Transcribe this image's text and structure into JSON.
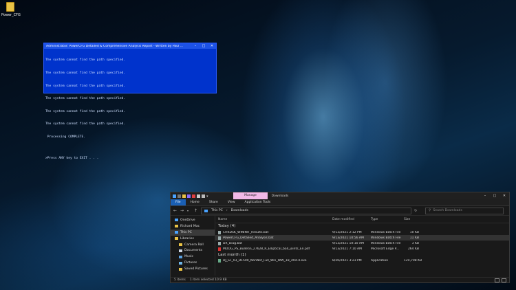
{
  "desktop": {
    "icon_label": "Power_CFG"
  },
  "console": {
    "title": "Administrator:  PowerCFG Detailed & Comprehensive Analysis Report - Written by Paul ...",
    "lines": [
      "The system cannot find the path specified.",
      "The system cannot find the path specified.",
      "The system cannot find the path specified.",
      "The system cannot find the path specified.",
      "The system cannot find the path specified.",
      "The system cannot find the path specified.",
      " Processing COMPLETE.",
      "",
      ">Press ANY key to EXIT . . ."
    ],
    "bg_color": "#0033cc"
  },
  "explorer": {
    "title_tabs": {
      "manage": "Manage",
      "downloads": "Downloads"
    },
    "ribbon_tabs": [
      "File",
      "Home",
      "Share",
      "View",
      "Application Tools"
    ],
    "address": {
      "this_pc": "This PC",
      "folder": "Downloads"
    },
    "search_placeholder": "Search Downloads",
    "nav_items": [
      {
        "label": "OneDrive"
      },
      {
        "label": "Richard Mac"
      },
      {
        "label": "This PC"
      },
      {
        "label": "Libraries"
      },
      {
        "label": "Camera Roll"
      },
      {
        "label": "Documents"
      },
      {
        "label": "Music"
      },
      {
        "label": "Pictures"
      },
      {
        "label": "Saved Pictures"
      }
    ],
    "columns": {
      "name": "Name",
      "date": "Date modified",
      "type": "Type",
      "size": "Size"
    },
    "groups": [
      {
        "title": "Today (4)",
        "files": [
          {
            "name": "CHKDSK_WININIT_Results.bat",
            "date": "9/13/2021 2:12 PM",
            "type": "Windows Batch File",
            "size": "10 KB"
          },
          {
            "name": "PowerCFG_Detailed_Analysis.bat",
            "date": "9/13/2021 10:56 AM",
            "type": "Windows Batch File",
            "size": "11 KB"
          },
          {
            "name": "DX_Diag.bat",
            "date": "9/13/2021 10:10 AM",
            "type": "Windows Batch File",
            "size": "3 KB"
          },
          {
            "name": "MOOG_PS_Bulletin_27628_R_Elliptical_ball_joints_En.pdf",
            "date": "9/13/2021 7:10 AM",
            "type": "Microsoft Edge P...",
            "size": "264 KB"
          }
        ]
      },
      {
        "title": "Last month (1)",
        "files": [
          {
            "name": "DJ_SF_03_D1500_NonNet_Full_Win_WW_1B_404-4.exe",
            "date": "8/20/2021 3:23 PM",
            "type": "Application",
            "size": "124,708 KB"
          }
        ]
      }
    ],
    "status": {
      "items": "5 items",
      "selected": "1 item selected  10.9 KB"
    }
  }
}
